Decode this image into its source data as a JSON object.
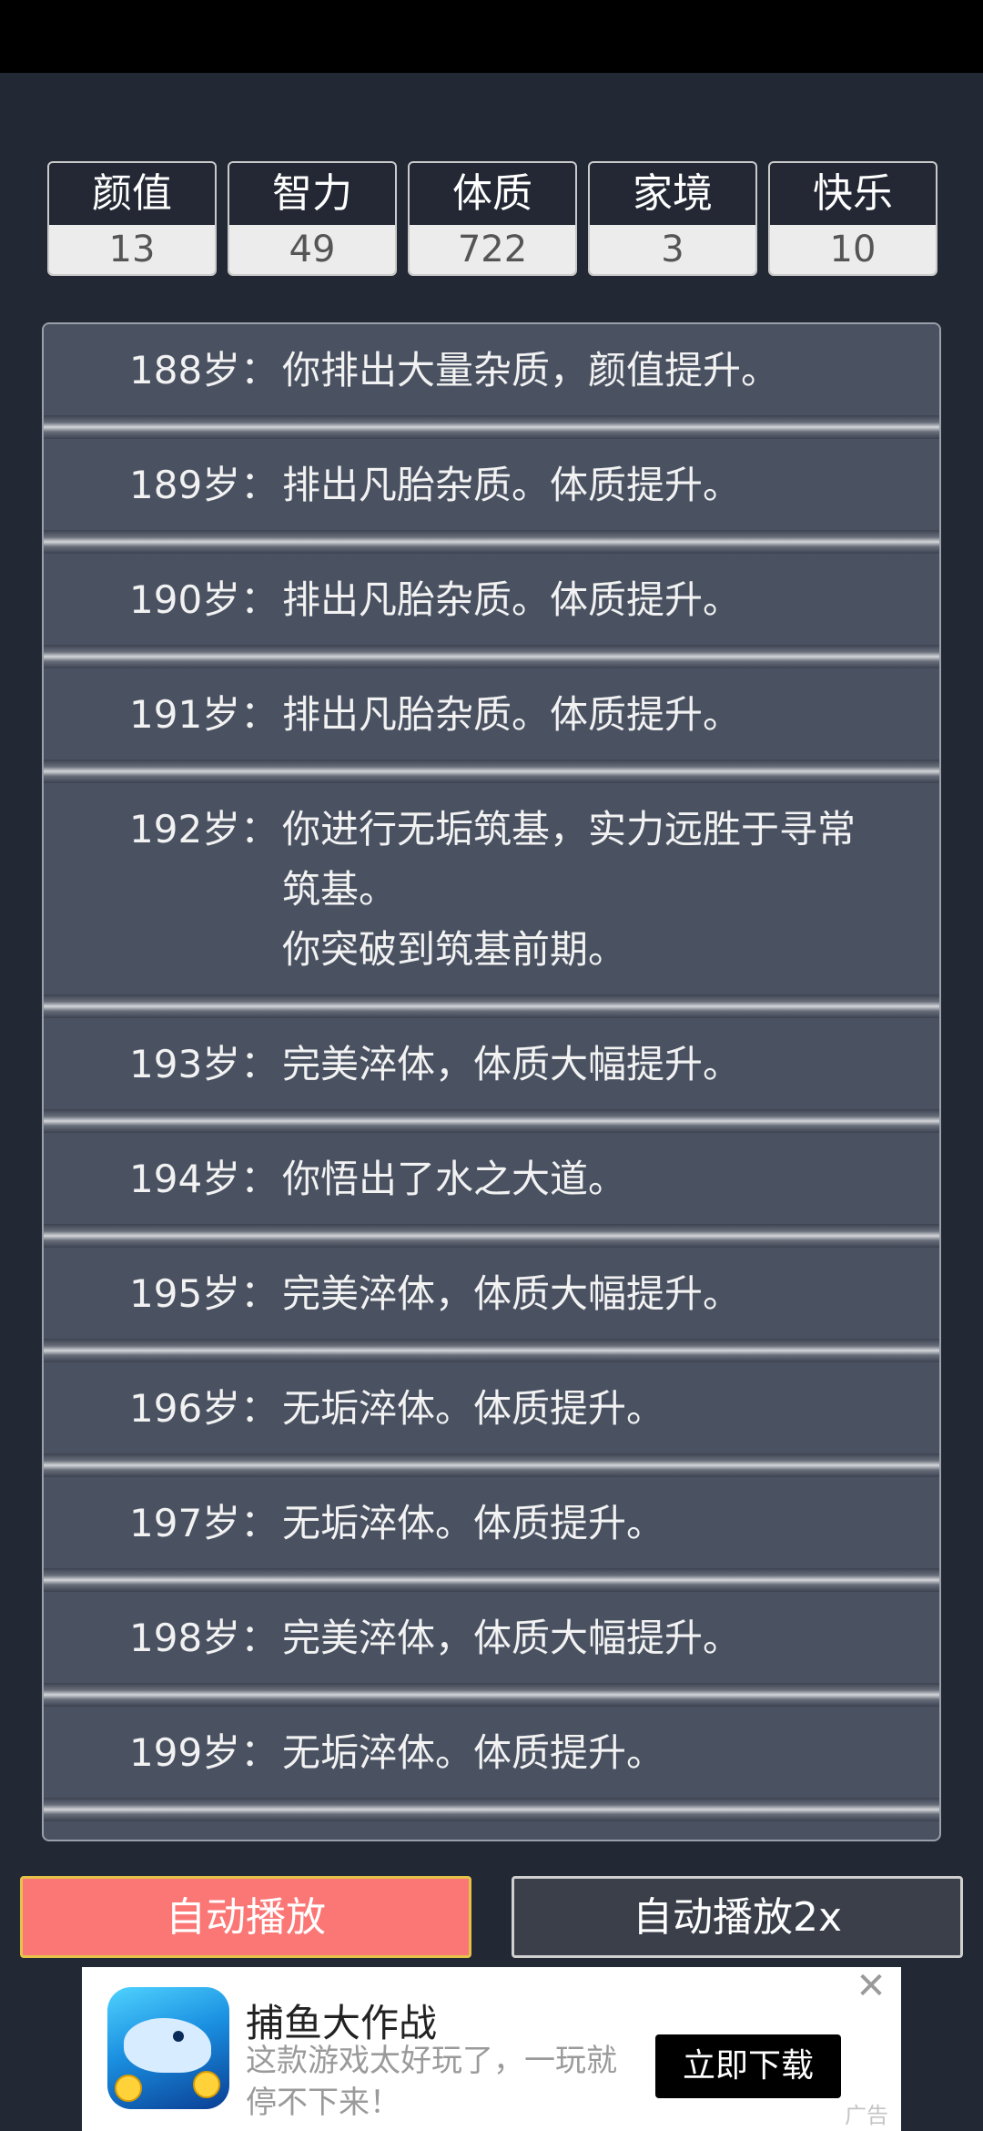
{
  "stats": [
    {
      "label": "颜值",
      "value": "13"
    },
    {
      "label": "智力",
      "value": "49"
    },
    {
      "label": "体质",
      "value": "722"
    },
    {
      "label": "家境",
      "value": "3"
    },
    {
      "label": "快乐",
      "value": "10"
    }
  ],
  "log": [
    {
      "age": "188岁：",
      "lines": [
        "你排出大量杂质，颜值提升。"
      ]
    },
    {
      "age": "189岁：",
      "lines": [
        "排出凡胎杂质。体质提升。"
      ]
    },
    {
      "age": "190岁：",
      "lines": [
        "排出凡胎杂质。体质提升。"
      ]
    },
    {
      "age": "191岁：",
      "lines": [
        "排出凡胎杂质。体质提升。"
      ]
    },
    {
      "age": "192岁：",
      "lines": [
        "你进行无垢筑基，实力远胜于寻常",
        "筑基。",
        "你突破到筑基前期。"
      ]
    },
    {
      "age": "193岁：",
      "lines": [
        "完美淬体，体质大幅提升。"
      ]
    },
    {
      "age": "194岁：",
      "lines": [
        "你悟出了水之大道。"
      ]
    },
    {
      "age": "195岁：",
      "lines": [
        "完美淬体，体质大幅提升。"
      ]
    },
    {
      "age": "196岁：",
      "lines": [
        "无垢淬体。体质提升。"
      ]
    },
    {
      "age": "197岁：",
      "lines": [
        "无垢淬体。体质提升。"
      ]
    },
    {
      "age": "198岁：",
      "lines": [
        "完美淬体，体质大幅提升。"
      ]
    },
    {
      "age": "199岁：",
      "lines": [
        "无垢淬体。体质提升。"
      ]
    }
  ],
  "buttons": {
    "auto": "自动播放",
    "auto2x": "自动播放2x"
  },
  "ad": {
    "title": "捕鱼大作战",
    "desc": "这款游戏太好玩了，一玩就停不下来！",
    "cta": "立即下载",
    "close": "✕",
    "label": "广告"
  }
}
